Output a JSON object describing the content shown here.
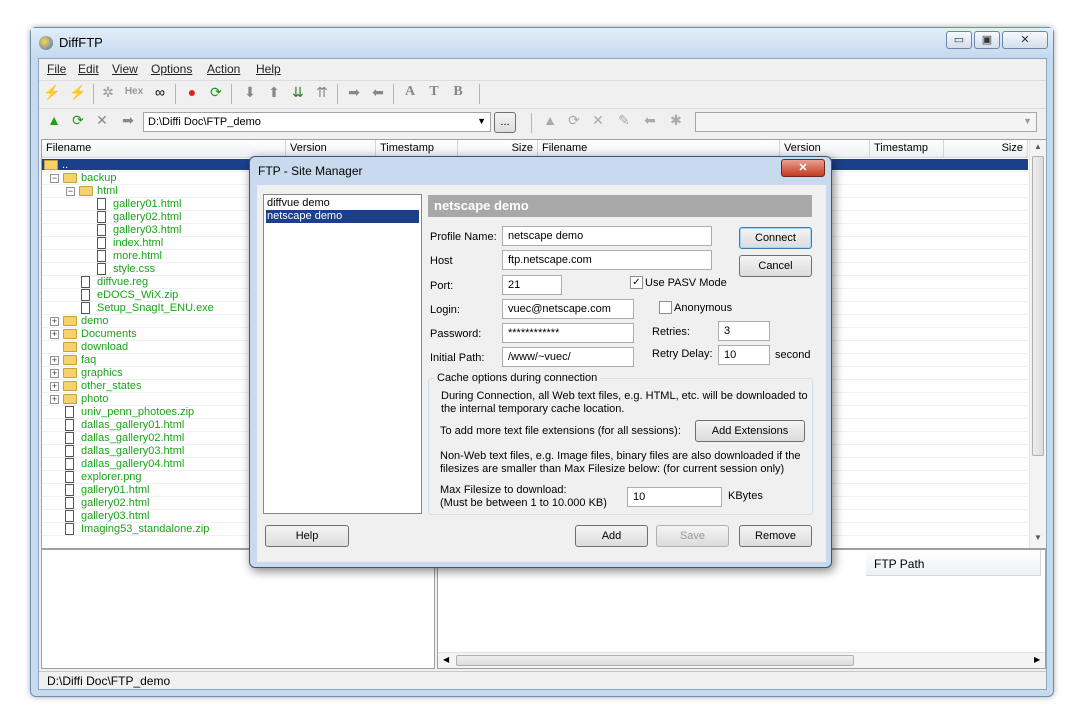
{
  "app": {
    "title": "DiffFTP"
  },
  "menu": [
    "File",
    "Edit",
    "View",
    "Options",
    "Action",
    "Help"
  ],
  "toolbar": {
    "hex_label": "Hex",
    "a_label": "A",
    "t_label": "T",
    "b_label": "B"
  },
  "address": {
    "path": "D:\\Diffi Doc\\FTP_demo",
    "browse": "...",
    "right_path": ""
  },
  "left_columns": [
    "Filename",
    "Version",
    "Timestamp",
    "Size"
  ],
  "right_columns": [
    "Filename",
    "Version",
    "Timestamp",
    "Size"
  ],
  "tree": [
    {
      "label": "..",
      "level": 0,
      "kind": "folder"
    },
    {
      "label": "backup",
      "level": 1,
      "kind": "folder-open"
    },
    {
      "label": "html",
      "level": 2,
      "kind": "folder-open"
    },
    {
      "label": "gallery01.html",
      "level": 3,
      "kind": "file"
    },
    {
      "label": "gallery02.html",
      "level": 3,
      "kind": "file"
    },
    {
      "label": "gallery03.html",
      "level": 3,
      "kind": "file"
    },
    {
      "label": "index.html",
      "level": 3,
      "kind": "file"
    },
    {
      "label": "more.html",
      "level": 3,
      "kind": "file"
    },
    {
      "label": "style.css",
      "level": 3,
      "kind": "file"
    },
    {
      "label": "diffvue.reg",
      "level": 2,
      "kind": "file"
    },
    {
      "label": "eDOCS_WiX.zip",
      "level": 2,
      "kind": "file"
    },
    {
      "label": "Setup_SnagIt_ENU.exe",
      "level": 2,
      "kind": "file"
    },
    {
      "label": "demo",
      "level": 1,
      "kind": "folder"
    },
    {
      "label": "Documents",
      "level": 1,
      "kind": "folder"
    },
    {
      "label": "download",
      "level": 1,
      "kind": "folder-noexp"
    },
    {
      "label": "faq",
      "level": 1,
      "kind": "folder"
    },
    {
      "label": "graphics",
      "level": 1,
      "kind": "folder"
    },
    {
      "label": "other_states",
      "level": 1,
      "kind": "folder"
    },
    {
      "label": "photo",
      "level": 1,
      "kind": "folder"
    },
    {
      "label": "univ_penn_photoes.zip",
      "level": 1,
      "kind": "file"
    },
    {
      "label": "dallas_gallery01.html",
      "level": 1,
      "kind": "file"
    },
    {
      "label": "dallas_gallery02.html",
      "level": 1,
      "kind": "file"
    },
    {
      "label": "dallas_gallery03.html",
      "level": 1,
      "kind": "file"
    },
    {
      "label": "dallas_gallery04.html",
      "level": 1,
      "kind": "file"
    },
    {
      "label": "explorer.png",
      "level": 1,
      "kind": "file"
    },
    {
      "label": "gallery01.html",
      "level": 1,
      "kind": "file"
    },
    {
      "label": "gallery02.html",
      "level": 1,
      "kind": "file"
    },
    {
      "label": "gallery03.html",
      "level": 1,
      "kind": "file"
    },
    {
      "label": "Imaging53_standalone.zip",
      "level": 1,
      "kind": "file"
    }
  ],
  "lower": {
    "ftp_path_header": "FTP Path"
  },
  "statusbar": {
    "path": "D:\\Diffi Doc\\FTP_demo"
  },
  "dialog": {
    "title": "FTP - Site Manager",
    "close": "✕",
    "profiles": [
      "diffvue demo",
      "netscape demo"
    ],
    "selected_profile": "netscape demo",
    "header": "netscape demo",
    "profile_name_label": "Profile Name:",
    "profile_name": "netscape demo",
    "host_label": "Host",
    "host": "ftp.netscape.com",
    "port_label": "Port:",
    "port": "21",
    "pasv_label": "Use PASV Mode",
    "login_label": "Login:",
    "login": "vuec@netscape.com",
    "anonymous_label": "Anonymous",
    "password_label": "Password:",
    "password": "************",
    "retries_label": "Retries:",
    "retries": "3",
    "initial_path_label": "Initial Path:",
    "initial_path": "/www/~vuec/",
    "retry_delay_label": "Retry Delay:",
    "retry_delay": "10",
    "second_label": "second",
    "connect": "Connect",
    "cancel": "Cancel",
    "cache_group": "Cache options during connection",
    "cache_text1": "During Connection, all Web text files, e.g. HTML, etc. will be downloaded to the internal temporary cache location.",
    "cache_text2": "To add more text file extensions (for all sessions):",
    "add_extensions": "Add Extensions",
    "cache_text3": "Non-Web text files, e.g. Image files, binary files are also downloaded if the filesizes are smaller than Max Filesize below: (for current session only)",
    "max_label1": "Max Filesize to download:",
    "max_label2": "(Must be between 1 to 10.000 KB)",
    "max_value": "10",
    "kbytes": "KBytes",
    "help": "Help",
    "add": "Add",
    "save": "Save",
    "remove": "Remove"
  }
}
